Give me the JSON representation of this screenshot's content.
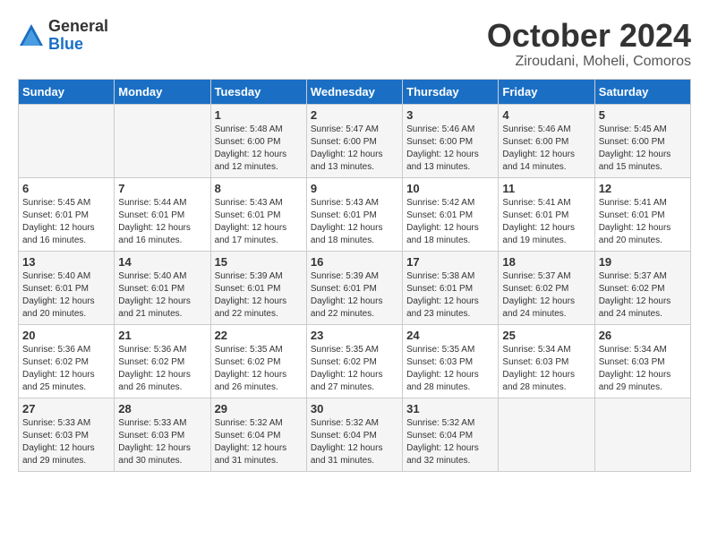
{
  "header": {
    "logo_general": "General",
    "logo_blue": "Blue",
    "month_title": "October 2024",
    "subtitle": "Ziroudani, Moheli, Comoros"
  },
  "days_of_week": [
    "Sunday",
    "Monday",
    "Tuesday",
    "Wednesday",
    "Thursday",
    "Friday",
    "Saturday"
  ],
  "weeks": [
    [
      {
        "day": "",
        "info": ""
      },
      {
        "day": "",
        "info": ""
      },
      {
        "day": "1",
        "info": "Sunrise: 5:48 AM\nSunset: 6:00 PM\nDaylight: 12 hours and 12 minutes."
      },
      {
        "day": "2",
        "info": "Sunrise: 5:47 AM\nSunset: 6:00 PM\nDaylight: 12 hours and 13 minutes."
      },
      {
        "day": "3",
        "info": "Sunrise: 5:46 AM\nSunset: 6:00 PM\nDaylight: 12 hours and 13 minutes."
      },
      {
        "day": "4",
        "info": "Sunrise: 5:46 AM\nSunset: 6:00 PM\nDaylight: 12 hours and 14 minutes."
      },
      {
        "day": "5",
        "info": "Sunrise: 5:45 AM\nSunset: 6:00 PM\nDaylight: 12 hours and 15 minutes."
      }
    ],
    [
      {
        "day": "6",
        "info": "Sunrise: 5:45 AM\nSunset: 6:01 PM\nDaylight: 12 hours and 16 minutes."
      },
      {
        "day": "7",
        "info": "Sunrise: 5:44 AM\nSunset: 6:01 PM\nDaylight: 12 hours and 16 minutes."
      },
      {
        "day": "8",
        "info": "Sunrise: 5:43 AM\nSunset: 6:01 PM\nDaylight: 12 hours and 17 minutes."
      },
      {
        "day": "9",
        "info": "Sunrise: 5:43 AM\nSunset: 6:01 PM\nDaylight: 12 hours and 18 minutes."
      },
      {
        "day": "10",
        "info": "Sunrise: 5:42 AM\nSunset: 6:01 PM\nDaylight: 12 hours and 18 minutes."
      },
      {
        "day": "11",
        "info": "Sunrise: 5:41 AM\nSunset: 6:01 PM\nDaylight: 12 hours and 19 minutes."
      },
      {
        "day": "12",
        "info": "Sunrise: 5:41 AM\nSunset: 6:01 PM\nDaylight: 12 hours and 20 minutes."
      }
    ],
    [
      {
        "day": "13",
        "info": "Sunrise: 5:40 AM\nSunset: 6:01 PM\nDaylight: 12 hours and 20 minutes."
      },
      {
        "day": "14",
        "info": "Sunrise: 5:40 AM\nSunset: 6:01 PM\nDaylight: 12 hours and 21 minutes."
      },
      {
        "day": "15",
        "info": "Sunrise: 5:39 AM\nSunset: 6:01 PM\nDaylight: 12 hours and 22 minutes."
      },
      {
        "day": "16",
        "info": "Sunrise: 5:39 AM\nSunset: 6:01 PM\nDaylight: 12 hours and 22 minutes."
      },
      {
        "day": "17",
        "info": "Sunrise: 5:38 AM\nSunset: 6:01 PM\nDaylight: 12 hours and 23 minutes."
      },
      {
        "day": "18",
        "info": "Sunrise: 5:37 AM\nSunset: 6:02 PM\nDaylight: 12 hours and 24 minutes."
      },
      {
        "day": "19",
        "info": "Sunrise: 5:37 AM\nSunset: 6:02 PM\nDaylight: 12 hours and 24 minutes."
      }
    ],
    [
      {
        "day": "20",
        "info": "Sunrise: 5:36 AM\nSunset: 6:02 PM\nDaylight: 12 hours and 25 minutes."
      },
      {
        "day": "21",
        "info": "Sunrise: 5:36 AM\nSunset: 6:02 PM\nDaylight: 12 hours and 26 minutes."
      },
      {
        "day": "22",
        "info": "Sunrise: 5:35 AM\nSunset: 6:02 PM\nDaylight: 12 hours and 26 minutes."
      },
      {
        "day": "23",
        "info": "Sunrise: 5:35 AM\nSunset: 6:02 PM\nDaylight: 12 hours and 27 minutes."
      },
      {
        "day": "24",
        "info": "Sunrise: 5:35 AM\nSunset: 6:03 PM\nDaylight: 12 hours and 28 minutes."
      },
      {
        "day": "25",
        "info": "Sunrise: 5:34 AM\nSunset: 6:03 PM\nDaylight: 12 hours and 28 minutes."
      },
      {
        "day": "26",
        "info": "Sunrise: 5:34 AM\nSunset: 6:03 PM\nDaylight: 12 hours and 29 minutes."
      }
    ],
    [
      {
        "day": "27",
        "info": "Sunrise: 5:33 AM\nSunset: 6:03 PM\nDaylight: 12 hours and 29 minutes."
      },
      {
        "day": "28",
        "info": "Sunrise: 5:33 AM\nSunset: 6:03 PM\nDaylight: 12 hours and 30 minutes."
      },
      {
        "day": "29",
        "info": "Sunrise: 5:32 AM\nSunset: 6:04 PM\nDaylight: 12 hours and 31 minutes."
      },
      {
        "day": "30",
        "info": "Sunrise: 5:32 AM\nSunset: 6:04 PM\nDaylight: 12 hours and 31 minutes."
      },
      {
        "day": "31",
        "info": "Sunrise: 5:32 AM\nSunset: 6:04 PM\nDaylight: 12 hours and 32 minutes."
      },
      {
        "day": "",
        "info": ""
      },
      {
        "day": "",
        "info": ""
      }
    ]
  ]
}
